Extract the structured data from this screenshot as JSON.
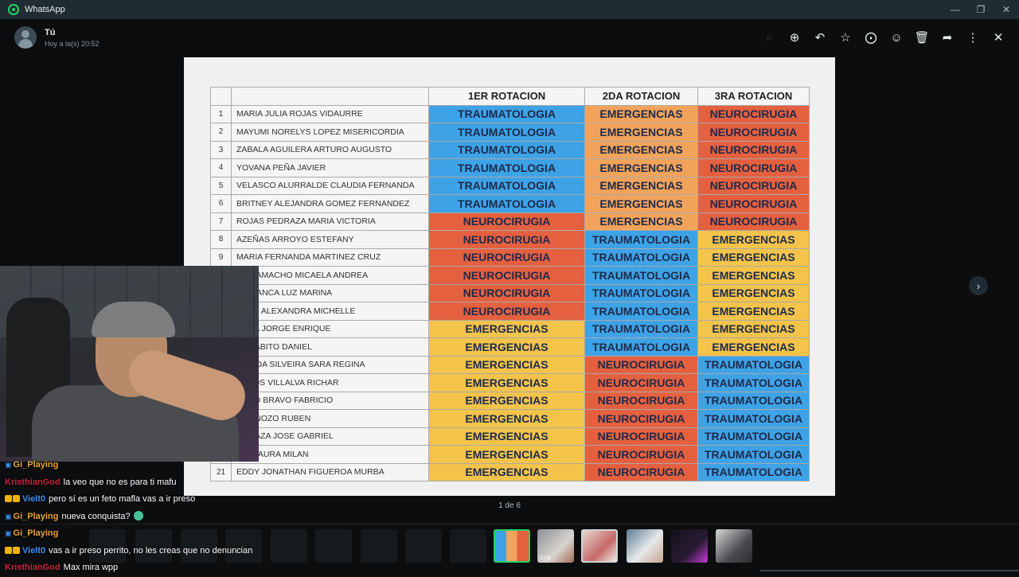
{
  "titlebar": {
    "app_title": "WhatsApp",
    "controls": [
      "—",
      "❐",
      "✕"
    ]
  },
  "header": {
    "sender_name": "Tú",
    "timestamp": "Hoy a la(s) 20:52"
  },
  "toolbar": {
    "icons": [
      "search-icon",
      "zoom-in-icon",
      "reply-icon",
      "star-icon",
      "pin-icon",
      "emoji-icon",
      "delete-icon",
      "forward-icon",
      "menu-icon",
      "close-icon"
    ]
  },
  "table": {
    "headers": [
      "",
      "",
      "1ER ROTACION",
      "2DA ROTACION",
      "3RA ROTACION"
    ],
    "rows": [
      {
        "n": "1",
        "name": "MARIA JULIA ROJAS VIDAURRE",
        "r1": "TRAUMATOLOGIA",
        "r2": "EMERGENCIAS",
        "r3": "NEUROCIRUGIA"
      },
      {
        "n": "2",
        "name": "MAYUMI NORELYS LOPEZ MISERICORDIA",
        "r1": "TRAUMATOLOGIA",
        "r2": "EMERGENCIAS",
        "r3": "NEUROCIRUGIA"
      },
      {
        "n": "3",
        "name": "ZABALA AGUILERA ARTURO AUGUSTO",
        "r1": "TRAUMATOLOGIA",
        "r2": "EMERGENCIAS",
        "r3": "NEUROCIRUGIA"
      },
      {
        "n": "4",
        "name": "YOVANA PEÑA JAVIER",
        "r1": "TRAUMATOLOGIA",
        "r2": "EMERGENCIAS",
        "r3": "NEUROCIRUGIA"
      },
      {
        "n": "5",
        "name": "VELASCO ALURRALDE CLAUDIA FERNANDA",
        "r1": "TRAUMATOLOGIA",
        "r2": "EMERGENCIAS",
        "r3": "NEUROCIRUGIA"
      },
      {
        "n": "6",
        "name": "BRITNEY ALEJANDRA GOMEZ FERNANDEZ",
        "r1": "TRAUMATOLOGIA",
        "r2": "EMERGENCIAS",
        "r3": "NEUROCIRUGIA"
      },
      {
        "n": "7",
        "name": "ROJAS PEDRAZA MARIA VICTORIA",
        "r1": "NEUROCIRUGIA",
        "r2": "EMERGENCIAS",
        "r3": "NEUROCIRUGIA"
      },
      {
        "n": "8",
        "name": "AZEÑAS ARROYO ESTEFANY",
        "r1": "NEUROCIRUGIA",
        "r2": "TRAUMATOLOGIA",
        "r3": "EMERGENCIAS"
      },
      {
        "n": "9",
        "name": "MARIA FERNANDA MARTINEZ CRUZ",
        "r1": "NEUROCIRUGIA",
        "r2": "TRAUMATOLOGIA",
        "r3": "EMERGENCIAS"
      },
      {
        "n": "",
        "name": "CA CAMACHO MICAELA ANDREA",
        "r1": "NEUROCIRUGIA",
        "r2": "TRAUMATOLOGIA",
        "r3": "EMERGENCIAS"
      },
      {
        "n": "",
        "name": "S HUANCA LUZ MARINA",
        "r1": "NEUROCIRUGIA",
        "r2": "TRAUMATOLOGIA",
        "r3": "EMERGENCIAS"
      },
      {
        "n": "",
        "name": "AZOS ALEXANDRA MICHELLE",
        "r1": "NEUROCIRUGIA",
        "r2": "TRAUMATOLOGIA",
        "r3": "EMERGENCIAS"
      },
      {
        "n": "",
        "name": "VEGA JORGE ENRIQUE",
        "r1": "EMERGENCIAS",
        "r2": "TRAUMATOLOGIA",
        "r3": "EMERGENCIAS"
      },
      {
        "n": "",
        "name": "GARABITO DANIEL",
        "r1": "EMERGENCIAS",
        "r2": "TRAUMATOLOGIA",
        "r3": "EMERGENCIAS"
      },
      {
        "n": "",
        "name": "OSA DA SILVEIRA SARA REGINA",
        "r1": "EMERGENCIAS",
        "r2": "NEUROCIRUGIA",
        "r3": "TRAUMATOLOGIA"
      },
      {
        "n": "",
        "name": "TEROS VILLALVA RICHAR",
        "r1": "EMERGENCIAS",
        "r2": "NEUROCIRUGIA",
        "r3": "TRAUMATOLOGIA"
      },
      {
        "n": "",
        "name": "RANO BRAVO FABRICIO",
        "r1": "EMERGENCIAS",
        "r2": "NEUROCIRUGIA",
        "r3": "TRAUMATOLOGIA"
      },
      {
        "n": "",
        "name": "S PANOZO RUBEN",
        "r1": "EMERGENCIAS",
        "r2": "NEUROCIRUGIA",
        "r3": "TRAUMATOLOGIA"
      },
      {
        "n": "",
        "name": "N APAZA JOSE GABRIEL",
        "r1": "EMERGENCIAS",
        "r2": "NEUROCIRUGIA",
        "r3": "TRAUMATOLOGIA"
      },
      {
        "n": "",
        "name": "LIA MAURA MILAN",
        "r1": "EMERGENCIAS",
        "r2": "NEUROCIRUGIA",
        "r3": "TRAUMATOLOGIA"
      },
      {
        "n": "21",
        "name": "EDDY JONATHAN FIGUEROA MURBA",
        "r1": "EMERGENCIAS",
        "r2": "NEUROCIRUGIA",
        "r3": "TRAUMATOLOGIA"
      }
    ]
  },
  "counter": "1 de 6",
  "thumbnails": {
    "video_duration": "0:04"
  },
  "chat": {
    "messages": [
      {
        "user": "Gi_Playing",
        "color": "#e8a43a",
        "badge": "twitch",
        "text": ""
      },
      {
        "user": "KristhianGod",
        "color": "#c4283a",
        "badge": "",
        "text": "la veo que no es para ti mafu"
      },
      {
        "user": "Vielt0",
        "color": "#3b8df0",
        "badge": "multi",
        "text": "pero sí es un feto mafla vas a ir preso"
      },
      {
        "user": "Gi_Playing",
        "color": "#e8a43a",
        "badge": "twitch",
        "text": "nueva conquista?"
      },
      {
        "user": "Gi_Playing",
        "color": "#e8a43a",
        "badge": "twitch",
        "text": ""
      },
      {
        "user": "Vielt0",
        "color": "#3b8df0",
        "badge": "multi",
        "text": "vas a ir preso perrito, no les creas que no denuncian"
      },
      {
        "user": "KristhianGod",
        "color": "#c4283a",
        "badge": "",
        "text": "Max mira wpp"
      }
    ]
  }
}
